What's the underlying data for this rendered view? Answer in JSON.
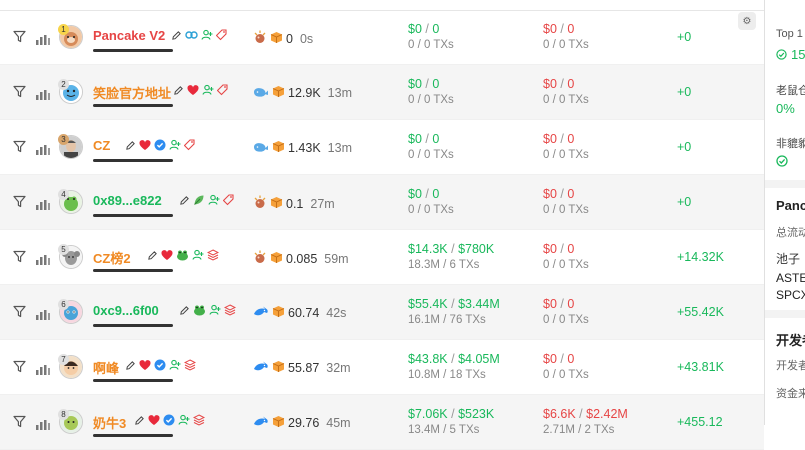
{
  "rows": [
    {
      "rank": "1",
      "rank_style": "gold",
      "name": "Pancake V2",
      "name_color": "red",
      "badges": [
        "edit",
        "link",
        "user",
        "tag"
      ],
      "src_icons": [
        "bomb",
        "box"
      ],
      "src_value": "0",
      "src_age": "0s",
      "buy_usd": "$0",
      "buy_usd2": "0",
      "buy_sub": "0 / 0 TXs",
      "sell_usd": "$0",
      "sell_usd2": "0",
      "sell_sub": "0 / 0 TXs",
      "pnl": "+0",
      "alt": false
    },
    {
      "rank": "2",
      "rank_style": "grey",
      "name": "笑脸官方地址",
      "name_color": "orange",
      "badges": [
        "edit",
        "heart",
        "user",
        "tag"
      ],
      "src_icons": [
        "whale",
        "box"
      ],
      "src_value": "12.9K",
      "src_age": "13m",
      "buy_usd": "$0",
      "buy_usd2": "0",
      "buy_sub": "0 / 0 TXs",
      "sell_usd": "$0",
      "sell_usd2": "0",
      "sell_sub": "0 / 0 TXs",
      "pnl": "+0",
      "alt": true
    },
    {
      "rank": "3",
      "rank_style": "bronze",
      "name": "CZ",
      "name_color": "orange",
      "badges": [
        "edit",
        "heart",
        "verified",
        "user",
        "tag"
      ],
      "src_icons": [
        "whale",
        "box"
      ],
      "src_value": "1.43K",
      "src_age": "13m",
      "buy_usd": "$0",
      "buy_usd2": "0",
      "buy_sub": "0 / 0 TXs",
      "sell_usd": "$0",
      "sell_usd2": "0",
      "sell_sub": "0 / 0 TXs",
      "pnl": "+0",
      "alt": false
    },
    {
      "rank": "4",
      "rank_style": "grey",
      "name": "0x89...e822",
      "name_color": "green",
      "badges": [
        "edit",
        "leaf",
        "user",
        "tag"
      ],
      "src_icons": [
        "bomb",
        "box"
      ],
      "src_value": "0.1",
      "src_age": "27m",
      "buy_usd": "$0",
      "buy_usd2": "0",
      "buy_sub": "0 / 0 TXs",
      "sell_usd": "$0",
      "sell_usd2": "0",
      "sell_sub": "0 / 0 TXs",
      "pnl": "+0",
      "alt": true
    },
    {
      "rank": "5",
      "rank_style": "grey",
      "name": "CZ榜2",
      "name_color": "orange",
      "badges": [
        "edit",
        "heart",
        "frog",
        "user",
        "stack"
      ],
      "src_icons": [
        "bomb",
        "box"
      ],
      "src_value": "0.085",
      "src_age": "59m",
      "buy_usd": "$14.3K",
      "buy_usd2": "$780K",
      "buy_sub": "18.3M / 6 TXs",
      "sell_usd": "$0",
      "sell_usd2": "0",
      "sell_sub": "0 / 0 TXs",
      "pnl": "+14.32K",
      "alt": false
    },
    {
      "rank": "6",
      "rank_style": "grey",
      "name": "0xc9...6f00",
      "name_color": "green",
      "badges": [
        "edit",
        "frog",
        "user",
        "stack"
      ],
      "src_icons": [
        "dolphin",
        "box"
      ],
      "src_value": "60.74",
      "src_age": "42s",
      "buy_usd": "$55.4K",
      "buy_usd2": "$3.44M",
      "buy_sub": "16.1M / 76 TXs",
      "sell_usd": "$0",
      "sell_usd2": "0",
      "sell_sub": "0 / 0 TXs",
      "pnl": "+55.42K",
      "alt": true
    },
    {
      "rank": "7",
      "rank_style": "grey",
      "name": "啊峰",
      "name_color": "orange",
      "badges": [
        "edit",
        "heart",
        "verified",
        "user",
        "stack"
      ],
      "src_icons": [
        "dolphin",
        "box"
      ],
      "src_value": "55.87",
      "src_age": "32m",
      "buy_usd": "$43.8K",
      "buy_usd2": "$4.05M",
      "buy_sub": "10.8M / 18 TXs",
      "sell_usd": "$0",
      "sell_usd2": "0",
      "sell_sub": "0 / 0 TXs",
      "pnl": "+43.81K",
      "alt": false
    },
    {
      "rank": "8",
      "rank_style": "grey",
      "name": "奶牛3",
      "name_color": "orange",
      "badges": [
        "edit",
        "heart",
        "verified",
        "user",
        "stack"
      ],
      "src_icons": [
        "dolphin",
        "box"
      ],
      "src_value": "29.76",
      "src_age": "45m",
      "buy_usd": "$7.06K",
      "buy_usd2": "$523K",
      "buy_sub": "13.4M / 5 TXs",
      "sell_usd": "$6.6K",
      "sell_usd2": "$2.42M",
      "sell_sub": "2.71M / 2 TXs",
      "pnl": "+455.12",
      "alt": true
    }
  ],
  "separator": "/",
  "right_panel": {
    "top_label": "Top 1",
    "top_value": "15",
    "label2": "老鼠仓",
    "value2": "0%",
    "label3": "非貔貅",
    "section_title": "Panc",
    "section_sub": "总流动",
    "pool_label": "池子",
    "pool_line1": "ASTE",
    "pool_line2": "SPCX",
    "dev_title": "开发者",
    "dev_label": "开发者",
    "fund_label": "资金来"
  },
  "colors": {
    "green": "#19b85b",
    "red": "#e64545",
    "orange": "#f08a24"
  }
}
